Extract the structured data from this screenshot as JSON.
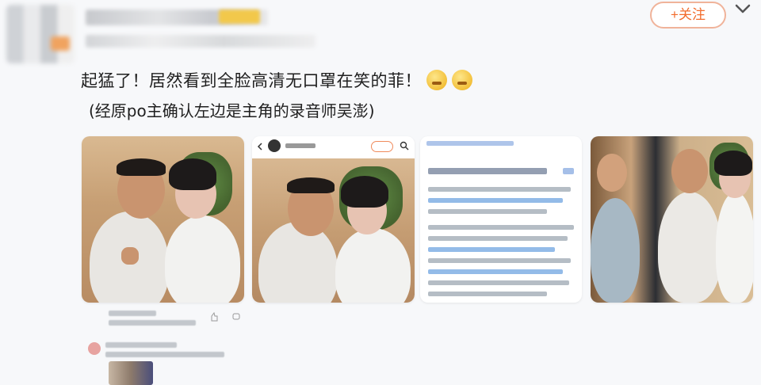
{
  "header": {
    "follow_label": "+关注"
  },
  "post": {
    "line1": "起猛了！居然看到全脸高清无口罩在笑的菲！",
    "line2": "(经原po主确认左边是主角的录音师吴澎)",
    "emojis": [
      "laughing-emoji",
      "laughing-emoji"
    ]
  },
  "colors": {
    "follow_border": "#f0b39a",
    "follow_text": "#f26b2c",
    "background": "#f7f8fa"
  }
}
